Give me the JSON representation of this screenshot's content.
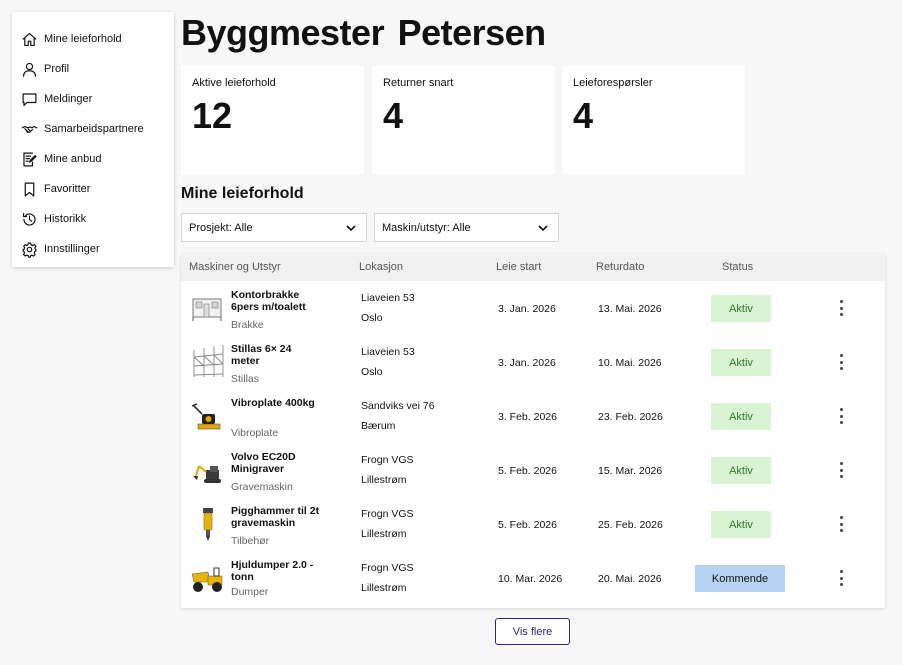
{
  "sidebar": {
    "items": [
      {
        "label": "Mine leieforhold",
        "icon": "home-icon"
      },
      {
        "label": "Profil",
        "icon": "user-icon"
      },
      {
        "label": "Meldinger",
        "icon": "message-icon"
      },
      {
        "label": "Samarbeidspartnere",
        "icon": "handshake-icon"
      },
      {
        "label": "Mine anbud",
        "icon": "document-edit-icon"
      },
      {
        "label": "Favoritter",
        "icon": "bookmark-icon"
      },
      {
        "label": "Historikk",
        "icon": "history-icon"
      },
      {
        "label": "Innstillinger",
        "icon": "gear-icon"
      }
    ]
  },
  "header": {
    "title": "Byggmester Petersen"
  },
  "stats": [
    {
      "title": "Aktive leieforhold",
      "value": "12"
    },
    {
      "title": "Returner snart",
      "value": "4"
    },
    {
      "title": "Leieforespørsler",
      "value": "4"
    }
  ],
  "section": {
    "title": "Mine leieforhold"
  },
  "filters": {
    "project": "Prosjekt: Alle",
    "machine": "Maskin/utstyr: Alle"
  },
  "table": {
    "columns": [
      "Maskiner og Utstyr",
      "Lokasjon",
      "Leie start",
      "Returdato",
      "Status"
    ],
    "rows": [
      {
        "name": "Kontorbrakke 6pers m/toalett",
        "category": "Brakke",
        "loc1": "Liaveien 53",
        "loc2": "Oslo",
        "start": "3. Jan. 2026",
        "return": "13. Mai. 2026",
        "status": "Aktiv",
        "thumb": "office-trailer-image"
      },
      {
        "name": "Stillas 6× 24 meter",
        "category": "Stillas",
        "loc1": "Liaveien 53",
        "loc2": "Oslo",
        "start": "3. Jan. 2026",
        "return": "10. Mai. 2026",
        "status": "Aktiv",
        "thumb": "scaffolding-image"
      },
      {
        "name": "Vibroplate 400kg",
        "category": "Vibroplate",
        "loc1": "Sandviks vei 76",
        "loc2": "Bærum",
        "start": "3. Feb. 2026",
        "return": "23. Feb. 2026",
        "status": "Aktiv",
        "thumb": "plate-compactor-image"
      },
      {
        "name": "Volvo EC20D Minigraver",
        "category": "Gravemaskin",
        "loc1": "Frogn VGS",
        "loc2": "Lillestrøm",
        "start": "5. Feb. 2026",
        "return": "15. Mar. 2026",
        "status": "Aktiv",
        "thumb": "mini-excavator-image"
      },
      {
        "name": "Pigghammer til 2t gravemaskin",
        "category": "Tilbehør",
        "loc1": "Frogn VGS",
        "loc2": "Lillestrøm",
        "start": "5. Feb. 2026",
        "return": "25. Feb. 2026",
        "status": "Aktiv",
        "thumb": "hydraulic-breaker-image"
      },
      {
        "name": "Hjuldumper 2.0 - tonn",
        "category": "Dumper",
        "loc1": "Frogn VGS",
        "loc2": "Lillestrøm",
        "start": "10. Mar. 2026",
        "return": "20. Mai. 2026",
        "status": "Kommende",
        "thumb": "wheel-dumper-image"
      }
    ]
  },
  "more_button": "Vis flere",
  "colors": {
    "active_bg": "#d8f4d2",
    "active_text": "#2f7a2a",
    "upcoming_bg": "#b6d3f3",
    "button_accent": "#2d2a7a"
  }
}
